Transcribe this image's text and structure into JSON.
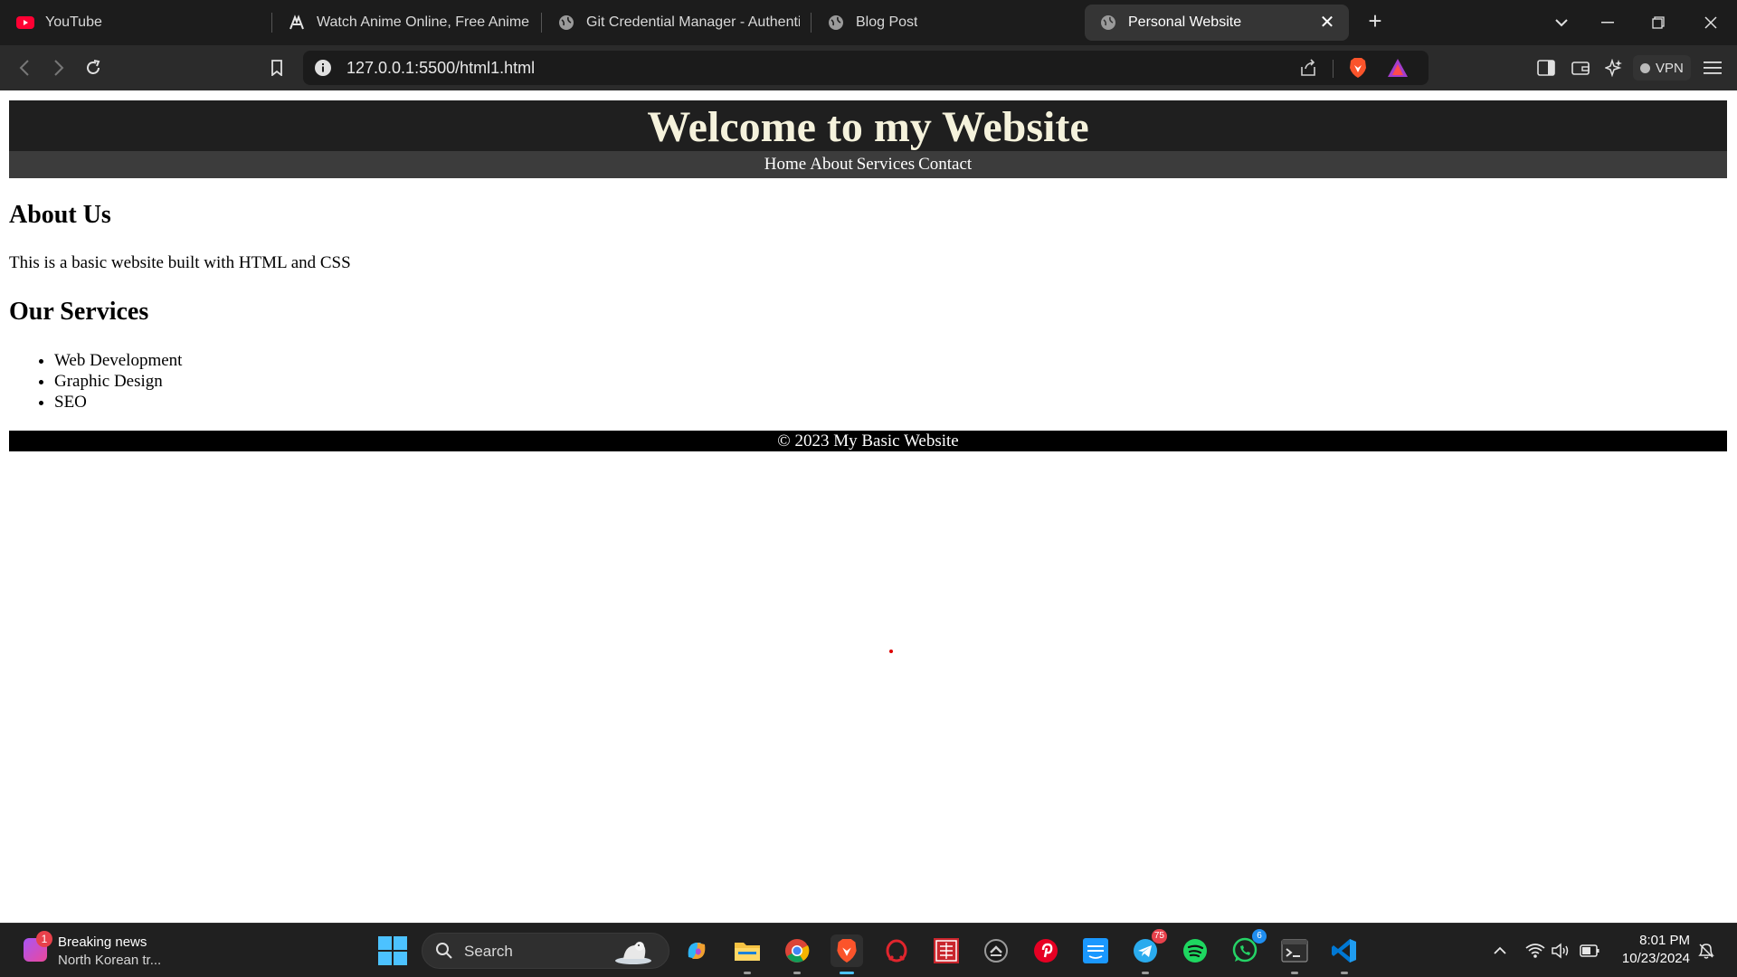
{
  "browser": {
    "tabs": [
      {
        "title": "YouTube",
        "icon": "youtube-icon"
      },
      {
        "title": "Watch Anime Online, Free Anime Str",
        "icon": "anime-site-icon"
      },
      {
        "title": "Git Credential Manager - Authentica",
        "icon": "globe-icon"
      },
      {
        "title": "Blog Post",
        "icon": "globe-icon"
      },
      {
        "title": "Personal Website",
        "icon": "globe-icon",
        "active": true
      }
    ],
    "url": "127.0.0.1:5500/html1.html",
    "vpn_label": "VPN",
    "accent_color": "#4cc2ff"
  },
  "site": {
    "title": "Welcome to my Website",
    "nav": [
      "Home",
      "About",
      "Services",
      "Contact"
    ],
    "about_heading": "About Us",
    "about_text": "This is a basic website built with HTML and CSS",
    "services_heading": "Our Services",
    "services": [
      "Web Development",
      "Graphic Design",
      "SEO"
    ],
    "footer": "© 2023 My Basic Website"
  },
  "taskbar": {
    "news": {
      "title": "Breaking news",
      "subtitle": "North Korean tr...",
      "badge": "1"
    },
    "search_label": "Search",
    "apps": [
      {
        "name": "copilot-icon"
      },
      {
        "name": "file-explorer-icon"
      },
      {
        "name": "chrome-icon"
      },
      {
        "name": "brave-icon"
      },
      {
        "name": "opera-icon"
      },
      {
        "name": "anime-app-icon"
      },
      {
        "name": "stremio-icon"
      },
      {
        "name": "pinterest-icon"
      },
      {
        "name": "prime-video-icon"
      },
      {
        "name": "telegram-icon",
        "badge": "75"
      },
      {
        "name": "spotify-icon"
      },
      {
        "name": "whatsapp-icon",
        "badge": "6"
      },
      {
        "name": "terminal-icon"
      },
      {
        "name": "vscode-icon"
      }
    ],
    "time": "8:01 PM",
    "date": "10/23/2024"
  }
}
